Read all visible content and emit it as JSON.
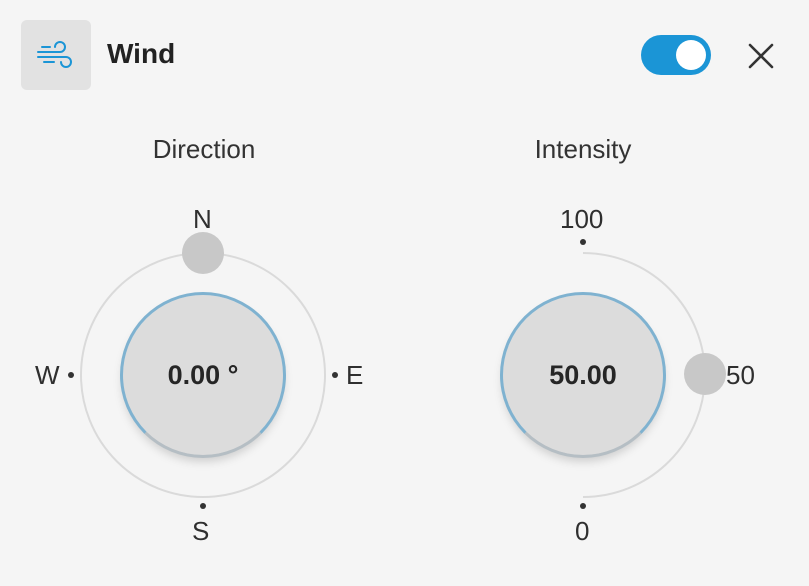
{
  "header": {
    "title": "Wind",
    "icon": "wind-icon",
    "toggle_on": true,
    "close_icon": "close-icon"
  },
  "direction": {
    "label": "Direction",
    "value_text": "0.00 °",
    "value": 0.0,
    "compass": {
      "n": "N",
      "e": "E",
      "s": "S",
      "w": "W"
    }
  },
  "intensity": {
    "label": "Intensity",
    "value_text": "50.00",
    "value": 50.0,
    "max_label": "100",
    "mid_label": "50",
    "min_label": "0"
  },
  "colors": {
    "accent": "#1b95d6",
    "dial_ring": "#7fb2d0"
  }
}
